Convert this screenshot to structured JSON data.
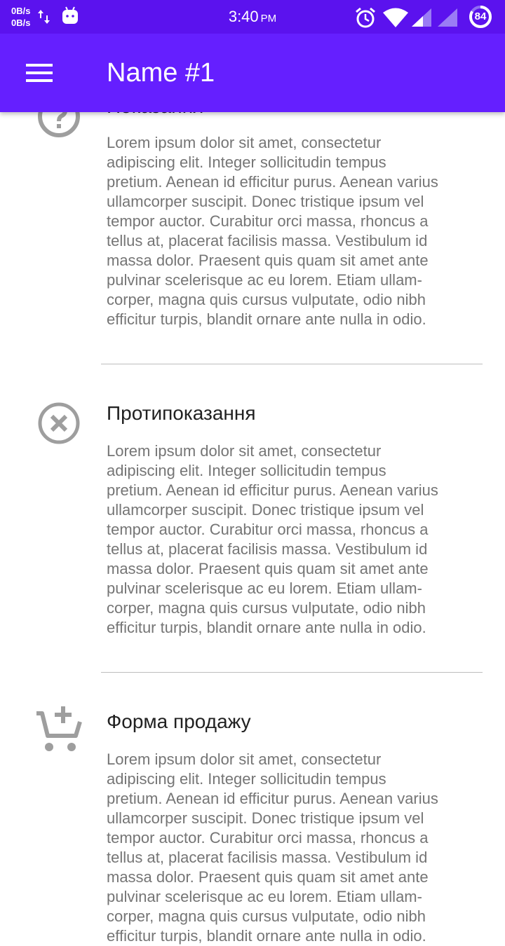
{
  "status_bar": {
    "net_up": "0B/s",
    "net_down": "0B/s",
    "time": "3:40",
    "ampm": "PM",
    "battery": "84",
    "icons": [
      "data-transfer-icon",
      "android-icon",
      "alarm-icon",
      "wifi-icon",
      "signal-icon",
      "signal-icon",
      "battery-icon"
    ]
  },
  "app_bar": {
    "title": "Name #1",
    "menu_icon": "menu-icon",
    "color": "#651fff"
  },
  "sections": [
    {
      "title": "Показання",
      "icon": "help-circle-icon",
      "body_lines": [
        "Lorem ipsum dolor sit amet, consectetur",
        "adipiscing elit. Integer sollicitudin tempus",
        "pretium. Aenean id efficitur purus. Aenean varius",
        "ullamcorper suscipit. Donec tristique ipsum vel",
        "tempor auctor. Curabitur orci massa, rhoncus a",
        "tellus at, placerat facilisis massa. Vestibulum id",
        "massa dolor. Praesent quis quam sit amet ante",
        "pulvinar scelerisque ac eu lorem. Etiam ullam-",
        "corper, magna quis cursus vulputate, odio nibh",
        "efficitur turpis, blandit ornare ante nulla in odio."
      ]
    },
    {
      "title": "Протипоказання",
      "icon": "cancel-circle-icon",
      "body_lines": [
        "Lorem ipsum dolor sit amet, consectetur",
        "adipiscing elit. Integer sollicitudin tempus",
        "pretium. Aenean id efficitur purus. Aenean varius",
        "ullamcorper suscipit. Donec tristique ipsum vel",
        "tempor auctor. Curabitur orci massa, rhoncus a",
        "tellus at, placerat facilisis massa. Vestibulum id",
        "massa dolor. Praesent quis quam sit amet ante",
        "pulvinar scelerisque ac eu lorem. Etiam ullam-",
        "corper, magna quis cursus vulputate, odio nibh",
        "efficitur turpis, blandit ornare ante nulla in odio."
      ]
    },
    {
      "title": "Форма продажу",
      "icon": "add-shopping-cart-icon",
      "body_lines": [
        "Lorem ipsum dolor sit amet, consectetur",
        "adipiscing elit. Integer sollicitudin tempus",
        "pretium. Aenean id efficitur purus. Aenean varius",
        "ullamcorper suscipit. Donec tristique ipsum vel",
        "tempor auctor. Curabitur orci massa, rhoncus a",
        "tellus at, placerat facilisis massa. Vestibulum id",
        "massa dolor. Praesent quis quam sit amet ante",
        "pulvinar scelerisque ac eu lorem. Etiam ullam-",
        "corper, magna quis cursus vulputate, odio nibh",
        "efficitur turpis, blandit ornare ante nulla in odio."
      ]
    }
  ]
}
